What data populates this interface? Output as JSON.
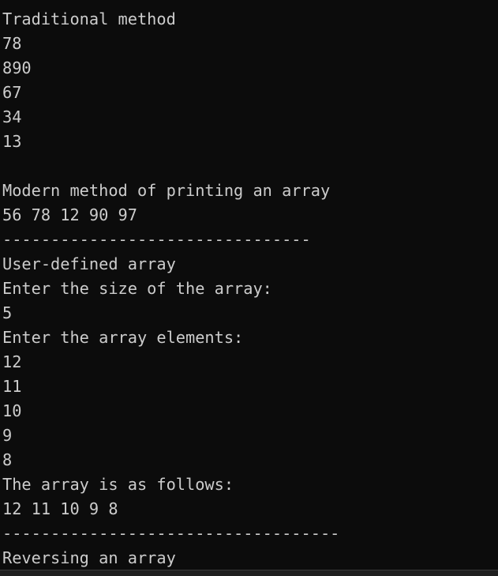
{
  "terminal": {
    "lines": [
      "Traditional method",
      "78",
      "890",
      "67",
      "34",
      "13",
      "",
      "Modern method of printing an array",
      "56 78 12 90 97",
      "--------------------------------",
      "User-defined array",
      "Enter the size of the array:",
      "5",
      "Enter the array elements:",
      "12",
      "11",
      "10",
      "9",
      "8",
      "The array is as follows:",
      "12 11 10 9 8",
      "-----------------------------------",
      "Reversing an array"
    ]
  },
  "colors": {
    "background": "#0c0c0c",
    "text": "#cccccc"
  }
}
